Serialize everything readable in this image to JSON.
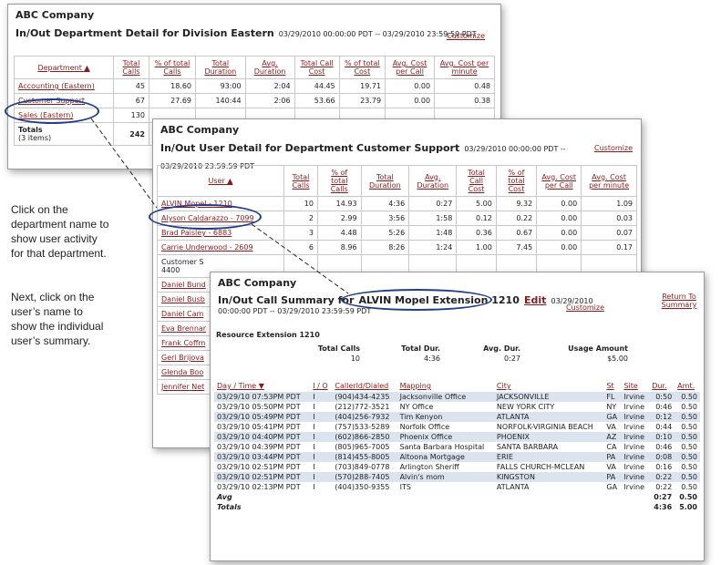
{
  "panel1": {
    "company": "ABC Company",
    "title": "In/Out Department Detail for Division Eastern",
    "range": "03/29/2010 00:00:00 PDT -- 03/29/2010 23:59:59 PDT",
    "customize": "Customize",
    "headers": [
      "Department",
      "Total Calls",
      "% of total Calls",
      "Total Duration",
      "Avg. Duration",
      "Total Call Cost",
      "% of total Cost",
      "Avg. Cost per Call",
      "Avg. Cost per minute"
    ],
    "sort_arrow": "▲",
    "rows": [
      [
        "Accounting (Eastern)",
        "45",
        "18.60",
        "93:00",
        "2:04",
        "44.45",
        "19.71",
        "0.00",
        "0.48"
      ],
      [
        "Customer Support",
        "67",
        "27.69",
        "140:44",
        "2:06",
        "53.66",
        "23.79",
        "0.00",
        "0.38"
      ],
      [
        "Sales (Eastern)",
        "130",
        "",
        "",
        "",
        "",
        "",
        "",
        ""
      ]
    ],
    "totals_label": "Totals",
    "totals_items": "(3 items)",
    "totals_calls": "242"
  },
  "panel2": {
    "company": "ABC Company",
    "title": "In/Out User Detail for Department Customer Support",
    "range": "03/29/2010 00:00:00 PDT -- 03/29/2010 23:59:59 PDT",
    "customize": "Customize",
    "headers": [
      "User",
      "Total Calls",
      "% of total Calls",
      "Total Duration",
      "Avg. Duration",
      "Total Call Cost",
      "% of total Cost",
      "Avg. Cost per Call",
      "Avg. Cost per minute"
    ],
    "sort_arrow": "▲",
    "rows": [
      [
        "ALVIN Mopel - 1210",
        "10",
        "14.93",
        "4:36",
        "0:27",
        "5.00",
        "9.32",
        "0.00",
        "1.09"
      ],
      [
        "Alyson Caldarazzo - 7099",
        "2",
        "2.99",
        "3:56",
        "1:58",
        "0.12",
        "0.22",
        "0.00",
        "0.03"
      ],
      [
        "Brad Paisley - 6883",
        "3",
        "4.48",
        "5:26",
        "1:48",
        "0.36",
        "0.67",
        "0.00",
        "0.07"
      ],
      [
        "Carrie Underwood - 2609",
        "6",
        "8.96",
        "8:26",
        "1:24",
        "1.00",
        "7.45",
        "0.00",
        "0.17"
      ]
    ],
    "extra_text": "Customer S",
    "extra_num": "4400",
    "more_users": [
      "Daniel Bund",
      "Daniel Busb",
      "Daniel Cam",
      "Eva Brennar",
      "Frank Coffm",
      "Geri Brijova",
      "Glenda Boo",
      "Jennifer Net"
    ]
  },
  "panel3": {
    "company": "ABC Company",
    "title_prefix": "In/Out Call Summary for",
    "title_name": "ALVIN Mopel Extension 1210",
    "edit": "Edit",
    "date": "03/29/2010",
    "range": "00:00:00 PDT -- 03/29/2010 23:59:59 PDT",
    "customize": "Customize",
    "return": "Return To Summary",
    "resource": "Resource Extension 1210",
    "sum_headers": [
      "Total Calls",
      "Total Dur.",
      "Avg. Dur.",
      "Usage Amount"
    ],
    "sum_values": [
      "10",
      "4:36",
      "0:27",
      "$5.00"
    ],
    "list_headers": [
      "Day / Time",
      "I / O",
      "CallerId/Dialed",
      "Mapping",
      "City",
      "St",
      "Site",
      "Dur.",
      "Amt."
    ],
    "sort_arrow": "▼",
    "rows": [
      [
        "03/29/10 07:53PM PDT",
        "I",
        "(904)434-4235",
        "Jacksonville Office",
        "JACKSONVILLE",
        "FL",
        "Irvine",
        "0:50",
        "0.50"
      ],
      [
        "03/29/10 05:50PM PDT",
        "I",
        "(212)772-3521",
        "NY Office",
        "NEW YORK CITY",
        "NY",
        "Irvine",
        "0:46",
        "0.50"
      ],
      [
        "03/29/10 05:49PM PDT",
        "I",
        "(404)256-7932",
        "Tim Kenyon",
        "ATLANTA",
        "GA",
        "Irvine",
        "0:12",
        "0.50"
      ],
      [
        "03/29/10 05:41PM PDT",
        "I",
        "(757)533-5289",
        "Norfolk Office",
        "NORFOLK-VIRGINIA BEACH",
        "VA",
        "Irvine",
        "0:44",
        "0.50"
      ],
      [
        "03/29/10 04:40PM PDT",
        "I",
        "(602)866-2850",
        "Phoenix Office",
        "PHOENIX",
        "AZ",
        "Irvine",
        "0:10",
        "0.50"
      ],
      [
        "03/29/10 04:39PM PDT",
        "I",
        "(805)965-7005",
        "Santa Barbara Hospital",
        "SANTA BARBARA",
        "CA",
        "Irvine",
        "0:46",
        "0.50"
      ],
      [
        "03/29/10 03:44PM PDT",
        "I",
        "(814)455-8005",
        "Altoona Mortgage",
        "ERIE",
        "PA",
        "Irvine",
        "0:08",
        "0.50"
      ],
      [
        "03/29/10 02:51PM PDT",
        "I",
        "(703)849-0778",
        "Arlington Sheriff",
        "FALLS CHURCH-MCLEAN",
        "VA",
        "Irvine",
        "0:16",
        "0.50"
      ],
      [
        "03/29/10 02:51PM PDT",
        "I",
        "(570)288-7405",
        "Alvin's mom",
        "KINGSTON",
        "PA",
        "Irvine",
        "0:22",
        "0.50"
      ],
      [
        "03/29/10 02:13PM PDT",
        "I",
        "(404)350-9355",
        "ITS",
        "ATLANTA",
        "GA",
        "Irvine",
        "0:22",
        "0.50"
      ]
    ],
    "avg_label": "Avg",
    "avg_dur": "0:27",
    "avg_amt": "0.50",
    "totals_label": "Totals",
    "tot_dur": "4:36",
    "tot_amt": "5.00"
  },
  "callout1": "Click on the department name to show user activity for that department.",
  "callout2": "Next, click on the user’s name to show the individual user’s summary.",
  "colors": {
    "link": "#8b1a1a",
    "oval": "#1f3d8a",
    "row_alt": "#dbe3ef"
  }
}
